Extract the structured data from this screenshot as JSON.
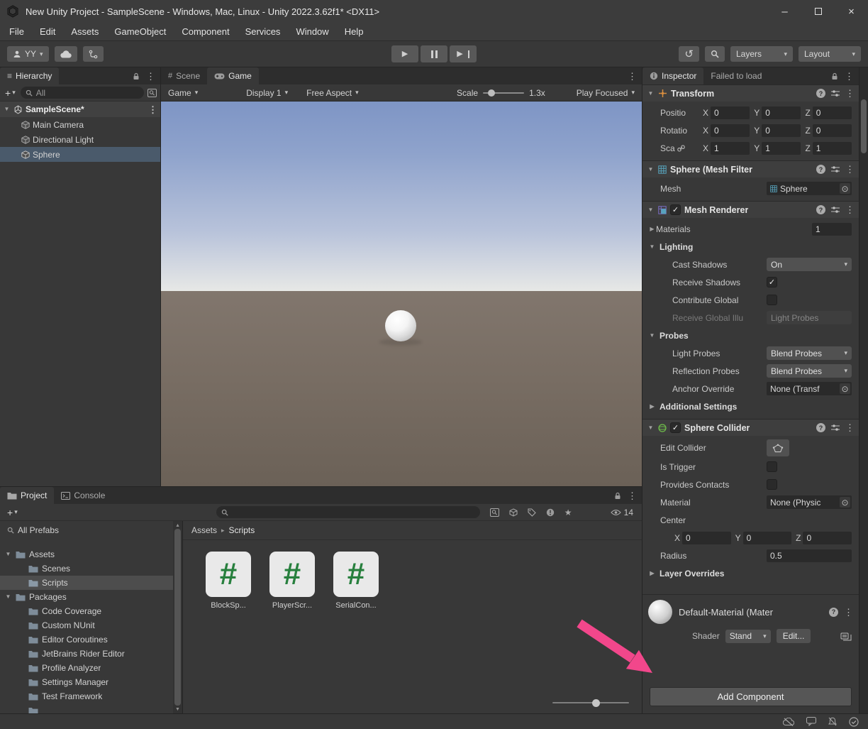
{
  "icons": {
    "kebab": "⋮",
    "caret": "▾",
    "foldout_open": "▼",
    "foldout_closed": "▶",
    "play": "▶",
    "history": "↺",
    "hamburger": "≡",
    "help": "?",
    "picker": "⊙",
    "check": "✓",
    "plus": "+",
    "minimize": "–",
    "close": "×",
    "star": "★",
    "crumb_sep": "▸",
    "hash": "#"
  },
  "titlebar": {
    "title": "New Unity Project - SampleScene - Windows, Mac, Linux - Unity 2022.3.62f1* <DX11>"
  },
  "menubar": {
    "items": [
      "File",
      "Edit",
      "Assets",
      "GameObject",
      "Component",
      "Services",
      "Window",
      "Help"
    ]
  },
  "toolbar": {
    "account": "YY",
    "layers": "Layers",
    "layout": "Layout"
  },
  "hierarchy": {
    "tab": "Hierarchy",
    "search": "All",
    "scene": "SampleScene*",
    "items": [
      "Main Camera",
      "Directional Light",
      "Sphere"
    ]
  },
  "viewport": {
    "scene_tab": "Scene",
    "game_tab": "Game",
    "game_menu": "Game",
    "display": "Display 1",
    "aspect": "Free Aspect",
    "scale_label": "Scale",
    "scale_value": "1.3x",
    "play_focused": "Play Focused"
  },
  "inspector": {
    "tab": "Inspector",
    "tab2": "Failed to load",
    "transform": {
      "title": "Transform",
      "position": "Positio",
      "rotation": "Rotatio",
      "scale": "Sca",
      "x": "X",
      "y": "Y",
      "z": "Z",
      "px": "0",
      "py": "0",
      "pz": "0",
      "rx": "0",
      "ry": "0",
      "rz": "0",
      "sx": "1",
      "sy": "1",
      "sz": "1"
    },
    "mesh_filter": {
      "title": "Sphere (Mesh Filter",
      "mesh": "Mesh",
      "value": "Sphere"
    },
    "renderer": {
      "title": "Mesh Renderer",
      "materials": "Materials",
      "materials_count": "1",
      "lighting": "Lighting",
      "cast_shadows": "Cast Shadows",
      "cast_shadows_value": "On",
      "receive_shadows": "Receive Shadows",
      "contribute_global": "Contribute Global",
      "receive_global": "Receive Global Illu",
      "receive_global_value": "Light Probes",
      "probes": "Probes",
      "light_probes": "Light Probes",
      "light_probes_value": "Blend Probes",
      "reflection_probes": "Reflection Probes",
      "reflection_probes_value": "Blend Probes",
      "anchor_override": "Anchor Override",
      "anchor_override_value": "None (Transf",
      "additional_settings": "Additional Settings"
    },
    "collider": {
      "title": "Sphere Collider",
      "edit_collider": "Edit Collider",
      "is_trigger": "Is Trigger",
      "provides_contacts": "Provides Contacts",
      "material": "Material",
      "material_value": "None (Physic",
      "center": "Center",
      "x": "X",
      "y": "Y",
      "z": "Z",
      "cx": "0",
      "cy": "0",
      "cz": "0",
      "radius": "Radius",
      "radius_value": "0.5",
      "layer_overrides": "Layer Overrides"
    },
    "material": {
      "title": "Default-Material (Mater",
      "shader": "Shader",
      "shader_value": "Stand",
      "edit": "Edit..."
    },
    "add_component": "Add Component"
  },
  "project": {
    "tab": "Project",
    "console_tab": "Console",
    "all_prefabs": "All Prefabs",
    "assets": "Assets",
    "assets_children": [
      "Scenes",
      "Scripts"
    ],
    "packages": "Packages",
    "packages_children": [
      "Code Coverage",
      "Custom NUnit",
      "Editor Coroutines",
      "JetBrains Rider Editor",
      "Profile Analyzer",
      "Settings Manager",
      "Test Framework"
    ],
    "crumb_root": "Assets",
    "crumb_current": "Scripts",
    "files": [
      "BlockSp...",
      "PlayerScr...",
      "SerialCon..."
    ],
    "hidden_count": "14"
  }
}
